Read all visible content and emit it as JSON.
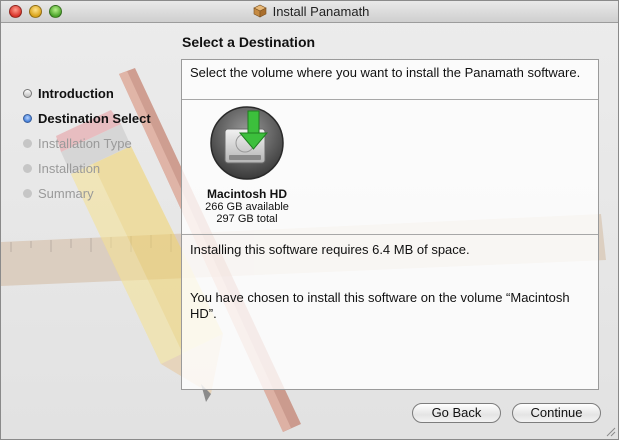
{
  "window": {
    "title": "Install Panamath"
  },
  "heading": "Select a Destination",
  "steps": [
    {
      "label": "Introduction",
      "state": "done"
    },
    {
      "label": "Destination Select",
      "state": "current"
    },
    {
      "label": "Installation Type",
      "state": "pending"
    },
    {
      "label": "Installation",
      "state": "pending"
    },
    {
      "label": "Summary",
      "state": "pending"
    }
  ],
  "panel": {
    "prompt": "Select the volume where you want to install the Panamath software.",
    "volume": {
      "name": "Macintosh HD",
      "available": "266 GB available",
      "total": "297 GB total",
      "icon": "hard-drive-with-green-arrow-icon"
    },
    "requirement": "Installing this software requires 6.4 MB of space.",
    "chosen": "You have chosen to install this software on the volume “Macintosh HD”."
  },
  "buttons": {
    "back": "Go Back",
    "continue": "Continue"
  },
  "colors": {
    "current_step": "#3c79d6",
    "arrow": "#3cbf3c",
    "panel_border": "#9a9a9a"
  }
}
